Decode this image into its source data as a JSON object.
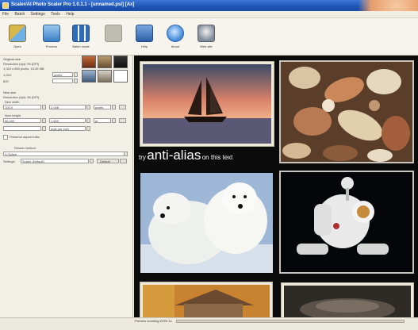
{
  "window": {
    "title": "Scaler/AI Photo Scaler Pro 1.0.1.1 - [unnamed.psi] [Ax]"
  },
  "menu": [
    "File",
    "Batch",
    "Settings",
    "Tools",
    "Help"
  ],
  "toolbar": [
    {
      "id": "open",
      "label": "Open",
      "icon": "open-icon"
    },
    {
      "id": "process",
      "label": "Process",
      "icon": "process-icon"
    },
    {
      "id": "batch",
      "label": "Batch mode",
      "icon": "batch-icon"
    },
    {
      "id": "blank",
      "label": "",
      "icon": "blank-icon"
    },
    {
      "id": "help",
      "label": "Help",
      "icon": "help-icon"
    },
    {
      "id": "about",
      "label": "About",
      "icon": "about-icon"
    },
    {
      "id": "website",
      "label": "Web site",
      "icon": "web-icon"
    }
  ],
  "left_panel": {
    "original": {
      "title": "Original size",
      "resolution": "Resolution (dpi): 96 (DPI)",
      "dimensions": "1,024 x 800 pixels, 15.26 MB",
      "width": "1,024",
      "height": "800",
      "unit": "pixels"
    },
    "new_size": {
      "title": "New size",
      "resolution": "Resolution (dpi): 96 (DPI)",
      "width_label": "New width",
      "width_value": "100.0",
      "width_px": "2,048",
      "width_unit": "pixels",
      "height_label": "New height",
      "height_value": "56,400",
      "height_px": "1,600",
      "unit2": "pt",
      "method": "dots per inch"
    },
    "keep_ratio_label": "Preserve aspect ratio",
    "resize_method_label": "Resize method",
    "resize_method_value": "S-Spline",
    "preset_label": "Settings",
    "preset_value": "Scaler (Default)",
    "preset_button": "Default"
  },
  "canvas": {
    "overlay_text": {
      "prefix": "try",
      "big": "anti-alias",
      "suffix": "on this text"
    }
  },
  "status": {
    "label": "Preview zooming",
    "value": "100%  1x"
  },
  "colors": {
    "titlebar": "#1f56b8",
    "canvas_bg": "#0b0b0b",
    "panel_bg": "#f2efe6"
  }
}
